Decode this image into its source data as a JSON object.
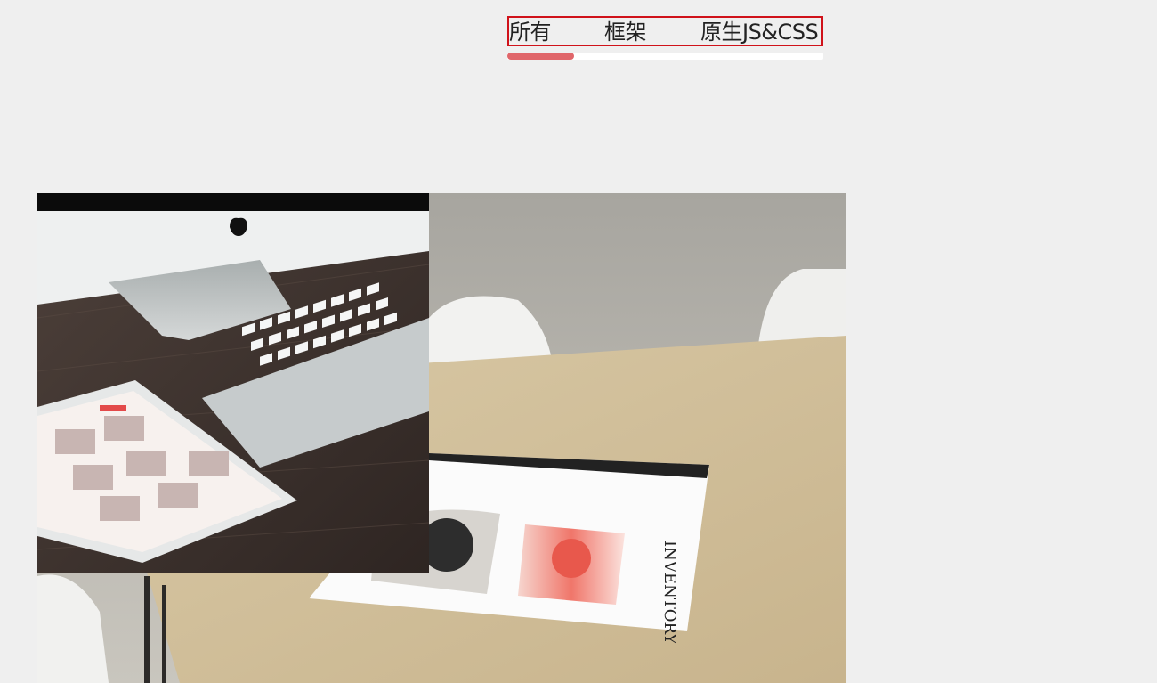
{
  "filter_tabs": {
    "all_label": "所有",
    "framework_label": "框架",
    "native_label": "原生JS&CSS",
    "active_progress": 0.21
  },
  "images": {
    "workspace_photo_text": "INVENTORY"
  },
  "colors": {
    "accent": "#d0121a",
    "progress": "#e0666a",
    "background": "#efefef"
  }
}
